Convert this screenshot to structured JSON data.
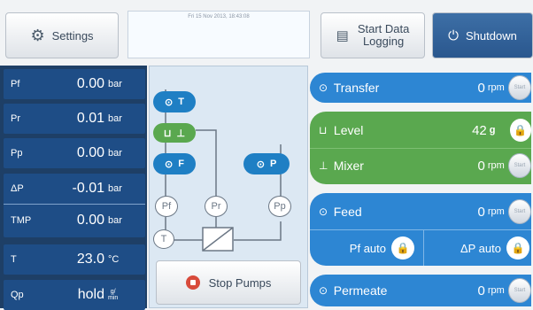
{
  "topbar": {
    "settings_label": "Settings",
    "datetime": "Fri 15 Nov 2013, 18:43:08",
    "logging_label_1": "Start Data",
    "logging_label_2": "Logging",
    "shutdown_label": "Shutdown"
  },
  "measurements": [
    {
      "label": "Pf",
      "value": "0.00",
      "unit": "bar"
    },
    {
      "label": "Pr",
      "value": "0.01",
      "unit": "bar"
    },
    {
      "label": "Pp",
      "value": "0.00",
      "unit": "bar"
    },
    {
      "label": "ΔP",
      "value": "-0.01",
      "unit": "bar"
    },
    {
      "label": "TMP",
      "value": "0.00",
      "unit": "bar"
    },
    {
      "label": "T",
      "value": "23.0",
      "unit": "°C"
    },
    {
      "label": "Qp",
      "value": "hold",
      "unit_top": "g/",
      "unit_bottom": "min"
    }
  ],
  "diagram": {
    "pump_T": "T",
    "pump_F": "F",
    "pump_P": "P",
    "node_pf": "Pf",
    "node_pr": "Pr",
    "node_pp": "Pp",
    "node_t": "T"
  },
  "stop_label": "Stop Pumps",
  "controls": {
    "transfer": {
      "name": "Transfer",
      "value": "0",
      "unit": "rpm",
      "button": "Start"
    },
    "level": {
      "name": "Level",
      "value": "42",
      "unit": "g"
    },
    "mixer": {
      "name": "Mixer",
      "value": "0",
      "unit": "rpm",
      "button": "Start"
    },
    "feed": {
      "name": "Feed",
      "value": "0",
      "unit": "rpm",
      "button": "Start"
    },
    "pf_auto": "Pf auto",
    "dp_auto": "ΔP auto",
    "permeate": {
      "name": "Permeate",
      "value": "0",
      "unit": "rpm",
      "button": "Start"
    }
  },
  "colors": {
    "blue": "#2d86d3",
    "green": "#5aa84f",
    "navy": "#1e4d86"
  }
}
